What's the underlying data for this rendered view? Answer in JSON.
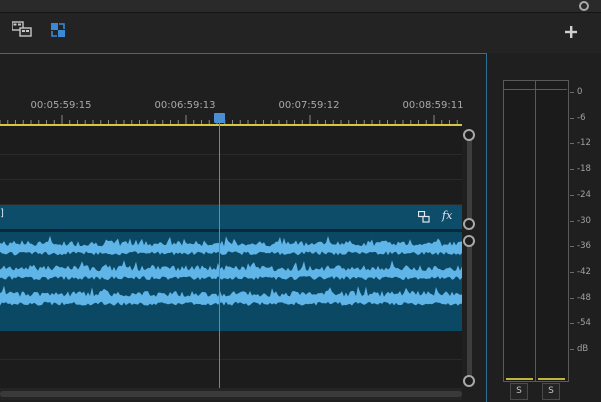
{
  "ruler": {
    "timecodes": [
      "00:05:59:15",
      "00:06:59:13",
      "00:07:59:12",
      "00:08:59:11"
    ]
  },
  "clip": {
    "label_fragment": "]"
  },
  "meter": {
    "scale": [
      "0",
      "-6",
      "-12",
      "-18",
      "-24",
      "-30",
      "-36",
      "-42",
      "-48",
      "-54",
      "dB"
    ],
    "solo_buttons": [
      "S",
      "S"
    ]
  },
  "icons": {
    "toolbar_left": "link-selection-icon",
    "toolbar_right": "add-marker-icon",
    "clip_effects": "fx-icon",
    "clip_link": "clip-link-icon"
  },
  "colors": {
    "clip": "#0a4864",
    "waveform": "#5fb4e8",
    "playhead": "#4b8ed6",
    "work_area": "#d6c640"
  }
}
